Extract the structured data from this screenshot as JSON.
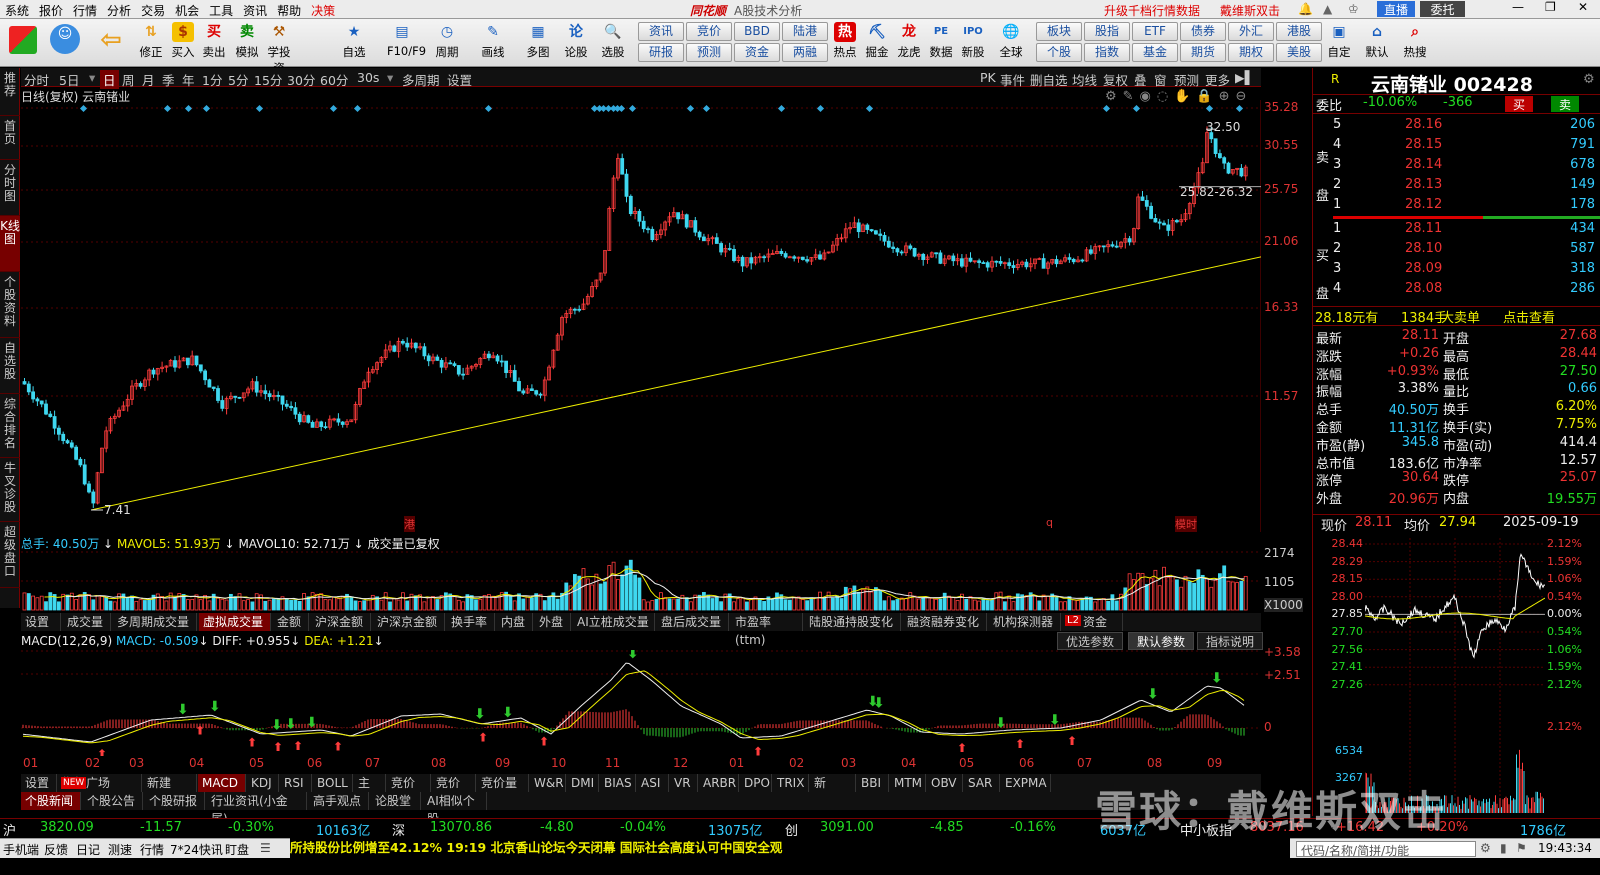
{
  "menu": [
    "系统",
    "报价",
    "行情",
    "分析",
    "交易",
    "机会",
    "工具",
    "资讯",
    "帮助",
    "决策"
  ],
  "menu_center": {
    "brand": "同花顺",
    "subtitle": "A股技术分析"
  },
  "menu_right": {
    "upgrade": "升级千档行情数据",
    "user": "戴维斯双击",
    "live": "直播",
    "entrust": "委托"
  },
  "toolbar": [
    {
      "label": "",
      "icon": "grid-icon"
    },
    {
      "label": "",
      "icon": "robot-icon"
    },
    {
      "label": "",
      "icon": "back-arrow-icon"
    },
    {
      "label": "修正",
      "icon": "up-down-arrow-icon"
    },
    {
      "label": "买入",
      "icon": "coin-icon"
    },
    {
      "label": "卖出",
      "icon": "buy-icon"
    },
    {
      "label": "模拟",
      "icon": "sell-icon"
    },
    {
      "label": "学投资",
      "icon": "hammer-icon"
    },
    {
      "label": "自选",
      "icon": "star-icon"
    },
    {
      "label": "F10/F9",
      "icon": "doc-icon"
    },
    {
      "label": "周期",
      "icon": "clock-icon"
    },
    {
      "label": "画线",
      "icon": "pen-icon"
    },
    {
      "label": "多图",
      "icon": "multi-chart-icon"
    },
    {
      "label": "论股",
      "icon": "discuss-icon"
    },
    {
      "label": "选股",
      "icon": "magnifier-icon"
    }
  ],
  "toolbar_grid": [
    "资讯",
    "竞价",
    "BBD",
    "陆港",
    "研报",
    "预测",
    "资金",
    "两融"
  ],
  "toolbar2": [
    "热点",
    "掘金",
    "龙虎",
    "数据",
    "新股",
    "全球"
  ],
  "toolbar_grid2": [
    "板块",
    "股指",
    "ETF",
    "债券",
    "外汇",
    "港股",
    "个股",
    "指数",
    "基金",
    "期货",
    "期权",
    "美股"
  ],
  "toolbar3": [
    "自定",
    "默认",
    "热搜"
  ],
  "leftnav": [
    "推荐",
    "首页",
    "分时图",
    "K线图",
    "个股资料",
    "自选股",
    "综合排名",
    "牛叉诊股",
    "超级盘口"
  ],
  "periods": [
    "分时",
    "5日",
    "日",
    "周",
    "月",
    "季",
    "年",
    "1分",
    "5分",
    "15分",
    "30分",
    "60分",
    "30s",
    "多周期",
    "设置"
  ],
  "periods_right": [
    "PK",
    "事件",
    "删自选",
    "均线",
    "复权",
    "叠",
    "窗",
    "预测",
    "更多"
  ],
  "kline": {
    "header": "日线(复权)  云南锗业",
    "price_ticks": [
      "35.28",
      "30.55",
      "25.75",
      "21.06",
      "16.33",
      "11.57"
    ],
    "high_label": "32.50",
    "low_label": "7.41",
    "range_label": "25.82-26.32",
    "event_marks": [
      "港",
      "q",
      "模时"
    ]
  },
  "volume": {
    "header_total": "总手: 40.50万",
    "mavol5": "MAVOL5: 51.93万",
    "mavol10": "MAVOL10: 52.71万",
    "note": "成交量已复权",
    "ticks": [
      "2174",
      "1105",
      "X1000"
    ]
  },
  "tabs1": [
    "设置",
    "成交量",
    "多周期成交量",
    "虚拟成交量",
    "金额",
    "沪深金额",
    "沪深京金额",
    "换手率",
    "内盘",
    "外盘",
    "AI立桩成交量",
    "盘后成交量",
    "市盈率(ttm)",
    "陆股通持股变化",
    "融资融券变化",
    "机构探测器",
    "资金抄底"
  ],
  "macd": {
    "name": "MACD(12,26,9)",
    "macd": "MACD: -0.509",
    "diff": "DIFF: +0.955",
    "dea": "DEA: +1.21",
    "ticks": [
      "+3.58",
      "+2.51",
      "0"
    ],
    "buttons": [
      "优选参数",
      "默认参数",
      "指标说明"
    ]
  },
  "months": [
    "01",
    "02",
    "03",
    "04",
    "05",
    "06",
    "07",
    "08",
    "09",
    "10",
    "11",
    "12",
    "01",
    "02",
    "03",
    "04",
    "05",
    "06",
    "07",
    "08",
    "09"
  ],
  "tabs2": [
    "设置",
    "指标广场",
    "新建",
    "MACD",
    "KDJ",
    "RSI",
    "BOLL",
    "主力",
    "竞价量",
    "竞价额",
    "竞价量比",
    "W&R",
    "DMI",
    "BIAS",
    "ASI",
    "VR",
    "ARBR",
    "DPO",
    "TRIX",
    "新DMA",
    "BBI",
    "MTM",
    "OBV",
    "SAR",
    "EXPMA"
  ],
  "tabs2_new_badge": "NEW",
  "tabs3": [
    "个股新闻",
    "个股公告",
    "个股研报",
    "行业资讯(小金属)",
    "高手观点",
    "论股堂",
    "AI相似个股"
  ],
  "quote": {
    "tag": "R",
    "name": "云南锗业 002428",
    "weibi_label": "委比",
    "weibi": "-10.06%",
    "weicha": "-366",
    "buy_btn": "买",
    "sell_btn": "卖",
    "sell_label": "卖盘",
    "buy_label": "买盘",
    "asks": [
      [
        "5",
        "28.16",
        "206"
      ],
      [
        "4",
        "28.15",
        "791"
      ],
      [
        "3",
        "28.14",
        "678"
      ],
      [
        "2",
        "28.13",
        "149"
      ],
      [
        "1",
        "28.12",
        "178"
      ]
    ],
    "bids": [
      [
        "1",
        "28.11",
        "434"
      ],
      [
        "2",
        "28.10",
        "587"
      ],
      [
        "3",
        "28.09",
        "318"
      ],
      [
        "4",
        "28.08",
        "286"
      ]
    ],
    "bigorder": {
      "price": "28.18元有",
      "vol": "1384手",
      "label": "大卖单",
      "link": "点击查看"
    },
    "stats": [
      [
        "最新",
        "28.11",
        "开盘",
        "27.68"
      ],
      [
        "涨跌",
        "+0.26",
        "最高",
        "28.44"
      ],
      [
        "涨幅",
        "+0.93%",
        "最低",
        "27.50"
      ],
      [
        "振幅",
        "3.38%",
        "量比",
        "0.66"
      ],
      [
        "总手",
        "40.50万",
        "换手",
        "6.20%"
      ],
      [
        "金额",
        "11.31亿",
        "换手(实)",
        "7.75%"
      ],
      [
        "市盈(静)",
        "345.8",
        "市盈(动)",
        "414.4"
      ],
      [
        "总市值",
        "183.6亿",
        "市净率",
        "12.57"
      ],
      [
        "涨停",
        "30.64",
        "跌停",
        "25.07"
      ],
      [
        "外盘",
        "20.96万",
        "内盘",
        "19.55万"
      ]
    ],
    "mini": {
      "now_label": "现价",
      "now": "28.11",
      "avg_label": "均价",
      "avg": "27.94",
      "date": "2025-09-19",
      "left_ticks": [
        "28.44",
        "28.29",
        "28.15",
        "28.00",
        "27.85",
        "27.70",
        "27.56",
        "27.41",
        "27.26"
      ],
      "right_ticks": [
        "2.12%",
        "1.59%",
        "1.06%",
        "0.54%",
        "0.00%",
        "0.54%",
        "1.06%",
        "1.59%",
        "2.12%"
      ],
      "vol_ticks": [
        "6534",
        "3267"
      ]
    }
  },
  "status": [
    {
      "name": "沪",
      "val": "3820.09",
      "chg": "-11.57",
      "pct": "-0.30%",
      "amt": "10163亿"
    },
    {
      "name": "深",
      "val": "13070.86",
      "chg": "-4.80",
      "pct": "-0.04%",
      "amt": "13075亿"
    },
    {
      "name": "创",
      "val": "3091.00",
      "chg": "-4.85",
      "pct": "-0.16%",
      "amt": "6037亿"
    },
    {
      "name": "中小板指",
      "val": "8037.16",
      "chg": "+16.42",
      "pct": "+0.20%",
      "amt": "1786亿"
    }
  ],
  "bottom": [
    "手机端",
    "反馈",
    "日记",
    "测速",
    "行情",
    "7*24快讯",
    "盯盘"
  ],
  "news": "所持股份比例增至42.12%          19:19 北京香山论坛今天闭幕 国际社会高度认可中国安全观",
  "bottom_right": {
    "search": "代码/名称/简拼/功能",
    "time": "19:43:34"
  },
  "watermark": "雪球：戴维斯双击"
}
